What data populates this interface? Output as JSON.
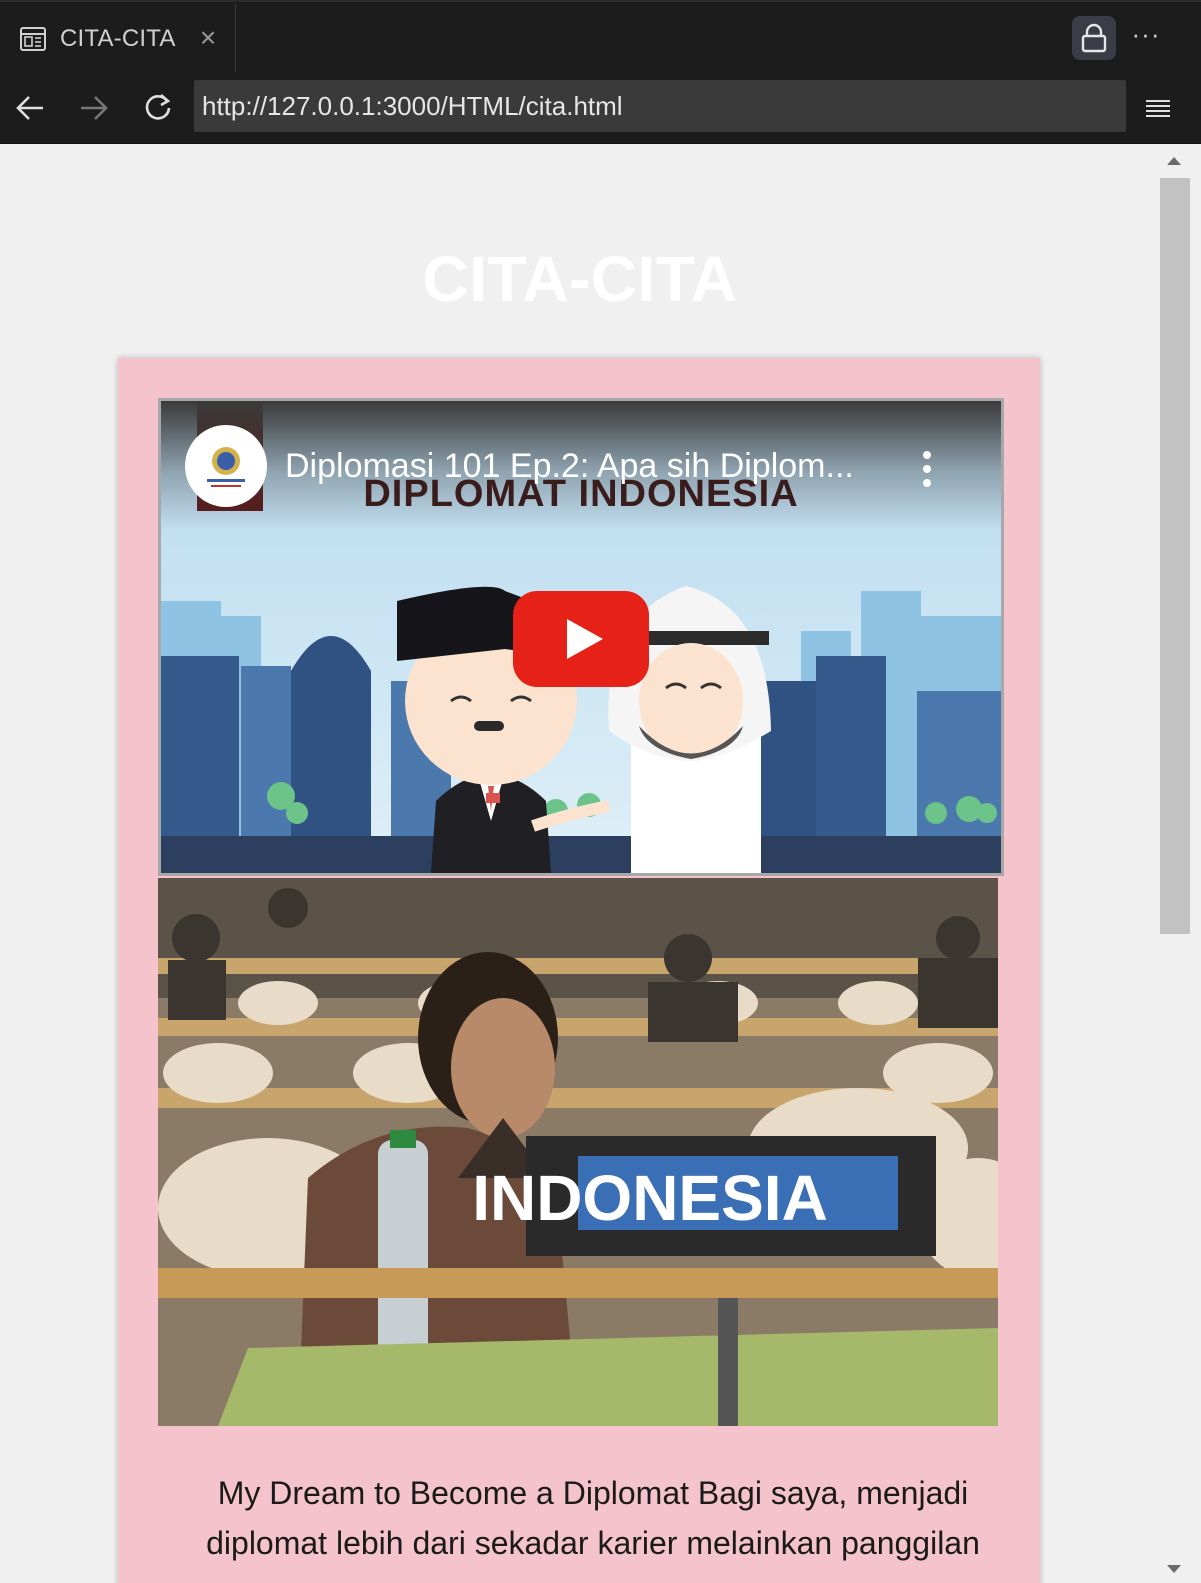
{
  "browser": {
    "tab_title": "CITA-CITA",
    "tab_close": "×",
    "url": "http://127.0.0.1:3000/HTML/cita.html",
    "more": "···"
  },
  "page": {
    "title": "CITA-CITA",
    "video": {
      "title": "Diplomasi 101 Ep.2: Apa sih Diplom...",
      "banner": "DIPLOMAT INDONESIA"
    },
    "photo": {
      "sign_text": "INDONESIA"
    },
    "description": "My Dream to Become a Diplomat Bagi saya, menjadi diplomat lebih dari sekadar karier melainkan panggilan"
  },
  "colors": {
    "card_bg": "#f5c3cb",
    "page_bg": "#f0f0f0",
    "play_red": "#e62117"
  }
}
